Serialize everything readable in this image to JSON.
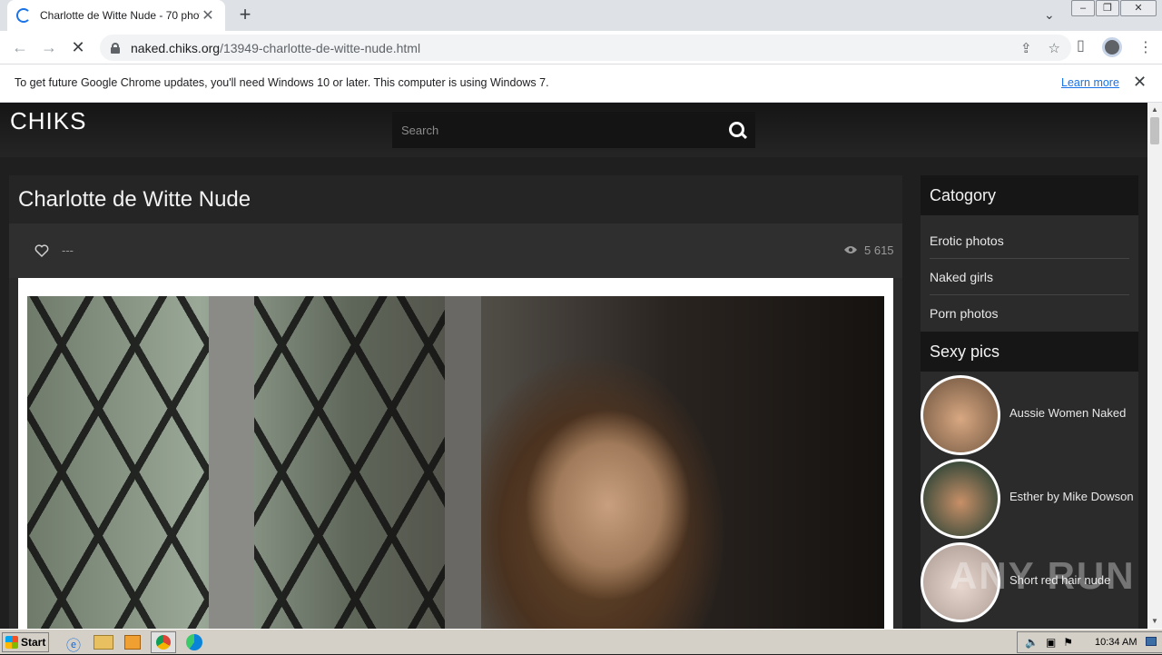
{
  "browser": {
    "tab_title": "Charlotte de Witte Nude - 70 photo",
    "url_host": "naked.chiks.org",
    "url_path": "/13949-charlotte-de-witte-nude.html",
    "infobar_text": "To get future Google Chrome updates, you'll need Windows 10 or later. This computer is using Windows 7.",
    "infobar_link": "Learn more"
  },
  "site": {
    "logo": "CHIKS",
    "search_placeholder": "Search"
  },
  "article": {
    "title": "Charlotte de Witte Nude",
    "rating": "---",
    "views": "5 615"
  },
  "sidebar": {
    "category_heading": "Catogory",
    "categories": [
      "Erotic photos",
      "Naked girls",
      "Porn photos"
    ],
    "sexy_heading": "Sexy pics",
    "pics": [
      "Aussie Women Naked",
      "Esther by Mike Dowson",
      "Short red hair nude"
    ]
  },
  "watermark": "ANY RUN",
  "taskbar": {
    "start_label": "Start",
    "clock": "10:34 AM"
  }
}
